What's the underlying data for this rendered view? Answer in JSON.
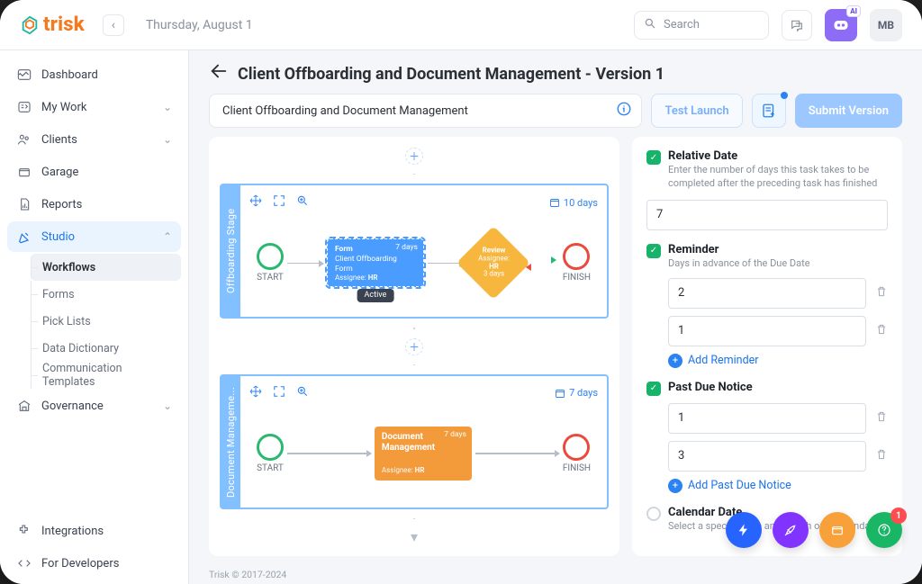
{
  "header": {
    "brand": "trisk",
    "date": "Thursday, August 1",
    "search_placeholder": "Search",
    "avatar_initials": "MB"
  },
  "sidebar": {
    "items": [
      {
        "icon": "dashboard-icon",
        "label": "Dashboard",
        "expandable": false
      },
      {
        "icon": "mywork-icon",
        "label": "My Work",
        "expandable": true
      },
      {
        "icon": "clients-icon",
        "label": "Clients",
        "expandable": true
      },
      {
        "icon": "garage-icon",
        "label": "Garage",
        "expandable": false
      },
      {
        "icon": "reports-icon",
        "label": "Reports",
        "expandable": false
      },
      {
        "icon": "studio-icon",
        "label": "Studio",
        "expandable": true,
        "active": true,
        "children": [
          {
            "label": "Workflows",
            "selected": true
          },
          {
            "label": "Forms"
          },
          {
            "label": "Pick Lists"
          },
          {
            "label": "Data Dictionary"
          },
          {
            "label": "Communication Templates"
          }
        ]
      },
      {
        "icon": "governance-icon",
        "label": "Governance",
        "expandable": true
      }
    ],
    "bottom": [
      {
        "icon": "integrations-icon",
        "label": "Integrations"
      },
      {
        "icon": "developers-icon",
        "label": "For Developers"
      }
    ]
  },
  "page": {
    "title": "Client Offboarding and Document Management - Version 1",
    "workflow_name": "Client Offboarding and Document Management",
    "btn_test_launch": "Test Launch",
    "btn_submit": "Submit Version"
  },
  "canvas": {
    "stages": [
      {
        "name": "Offboarding Stage",
        "days_label": "10 days",
        "start_label": "START",
        "finish_label": "FINISH",
        "form_card": {
          "type": "Form",
          "duration": "7 days",
          "title": "Client Offboarding Form",
          "assignee_label": "Assignee:",
          "assignee": "HR",
          "tooltip": "Active"
        },
        "review": {
          "title": "Review",
          "assignee_label": "Assignee:",
          "assignee": "HR",
          "duration": "3 days"
        }
      },
      {
        "name": "Document Manageme...",
        "days_label": "7 days",
        "start_label": "START",
        "finish_label": "FINISH",
        "form_card": {
          "type": "",
          "duration": "7 days",
          "title": "Document Management",
          "assignee_label": "Assignee:",
          "assignee": "HR"
        }
      }
    ]
  },
  "panel": {
    "relative": {
      "title": "Relative Date",
      "desc": "Enter the number of days this task takes to be completed after the preceding task has finished",
      "value": "7"
    },
    "reminder": {
      "title": "Reminder",
      "desc": "Days in advance of the Due Date",
      "values": [
        "2",
        "1"
      ],
      "add_label": "Add Reminder"
    },
    "past_due": {
      "title": "Past Due Notice",
      "values": [
        "1",
        "3"
      ],
      "add_label": "Add Past Due Notice"
    },
    "calendar": {
      "title": "Calendar Date",
      "desc": "Select a specific date and month on a calendar"
    }
  },
  "fabs": {
    "badge": "1"
  },
  "footer": "Trisk © 2017-2024"
}
